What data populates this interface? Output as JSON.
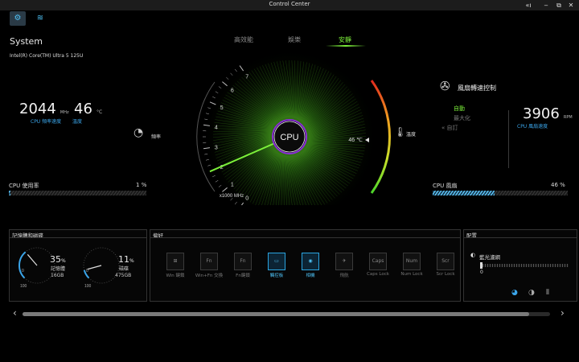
{
  "window": {
    "title": "Control Center",
    "win_icons": [
      "«ı",
      "‒",
      "⧉",
      "✕"
    ]
  },
  "top_icons": [
    {
      "name": "gear-grid-icon",
      "glyph": "⚙"
    },
    {
      "name": "fan-swirl-icon",
      "glyph": "≋"
    }
  ],
  "modes": [
    {
      "label": "高效能",
      "active": false
    },
    {
      "label": "娛樂",
      "active": false
    },
    {
      "label": "安靜",
      "active": true
    }
  ],
  "system": {
    "title": "System",
    "cpu_name": "Intel(R) Core(TM) Ultra 5 125U",
    "freq_value": "2044",
    "freq_unit": "MHz",
    "freq_label": "CPU 頻率速度",
    "temp_value": "46",
    "temp_unit": "°C",
    "temp_label": "溫度",
    "usage_label": "CPU 使用率",
    "usage_value": "1",
    "usage_unit": "%",
    "usage_fraction": 0.01
  },
  "gauge": {
    "center_label": "CPU",
    "ticks": [
      "7",
      "6",
      "5",
      "4",
      "3",
      "2",
      "1",
      "0"
    ],
    "unit": "x1000 MHz",
    "left_label": "頻率",
    "right_label": "溫度",
    "temp_readout": "46 ℃",
    "needle_value": 2.0
  },
  "fan": {
    "title": "風扇轉速控制",
    "modes": [
      "自動",
      "最大化",
      "自訂"
    ],
    "rpm_value": "3906",
    "rpm_unit": "RPM",
    "rpm_label": "CPU 風扇速度",
    "usage_label": "CPU 風扇",
    "usage_value": "46",
    "usage_unit": "%",
    "usage_fraction": 0.46
  },
  "memory": {
    "title": "記憶體和磁碟",
    "ram": {
      "percent": "35",
      "unit": "%",
      "label": "記憶體",
      "size": "16GB",
      "scale_min": "0",
      "scale_max": "100",
      "fraction": 0.35
    },
    "disk": {
      "percent": "11",
      "unit": "%",
      "label": "磁碟",
      "size": "475GB",
      "scale_min": "0",
      "scale_max": "100",
      "fraction": 0.11
    }
  },
  "prefs": {
    "title": "偏好",
    "items": [
      {
        "label": "Win 鍵鎖",
        "glyph": "⊞",
        "on": false,
        "name": "win-key-lock"
      },
      {
        "label": "Win+Fn 交換",
        "glyph": "Fn",
        "on": false,
        "name": "win-fn-swap"
      },
      {
        "label": "Fn鍵鎖",
        "glyph": "Fn",
        "on": false,
        "name": "fn-lock"
      },
      {
        "label": "觸控板",
        "glyph": "▭",
        "on": true,
        "name": "touchpad"
      },
      {
        "label": "相機",
        "glyph": "◉",
        "on": true,
        "name": "camera"
      },
      {
        "label": "飛航",
        "glyph": "✈",
        "on": false,
        "name": "airplane"
      },
      {
        "label": "Caps Lock",
        "glyph": "Caps",
        "on": false,
        "name": "caps-lock"
      },
      {
        "label": "Num Lock",
        "glyph": "Num",
        "on": false,
        "name": "num-lock"
      },
      {
        "label": "Scr Lock",
        "glyph": "Scr",
        "on": false,
        "name": "scr-lock"
      }
    ]
  },
  "config": {
    "title": "配置",
    "blue_light_label": "藍光濾網",
    "blue_light_value": "0",
    "blue_light_fraction": 0.0
  },
  "colors": {
    "accent_green": "#7cf03a",
    "accent_blue": "#3aa4e8"
  }
}
